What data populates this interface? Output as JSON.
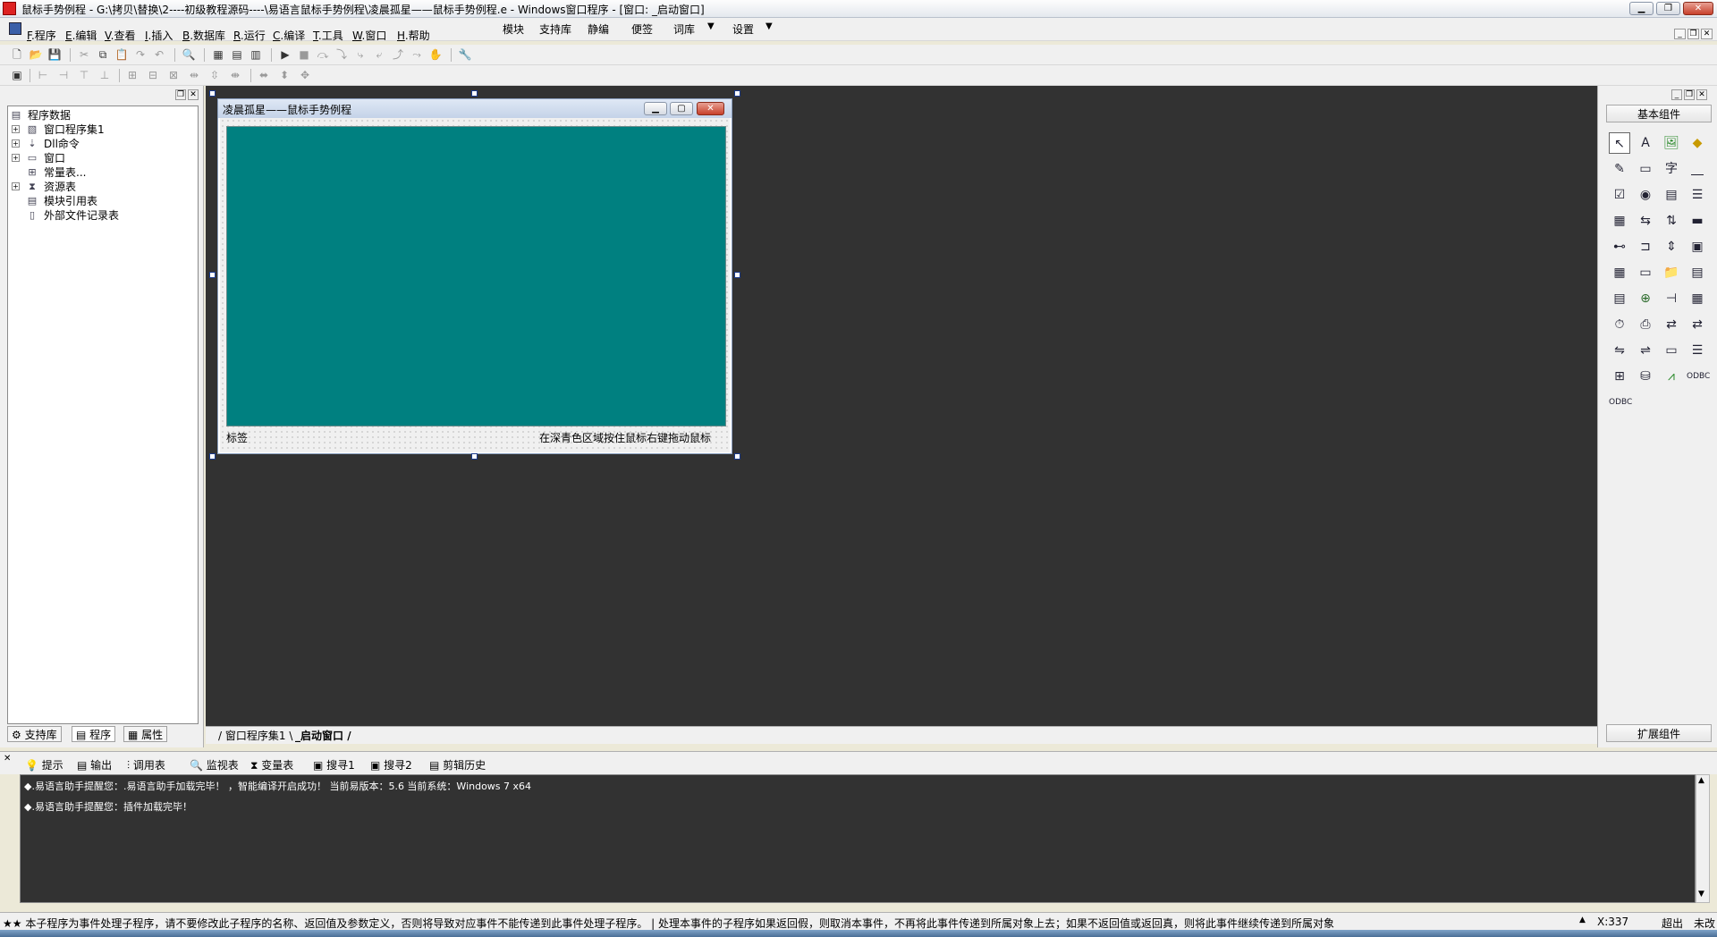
{
  "window": {
    "title": "鼠标手势例程 - G:\\拷贝\\替换\\2----初级教程源码----\\易语言鼠标手势例程\\凌晨孤星——鼠标手势例程.e - Windows窗口程序 - [窗口: _启动窗口]"
  },
  "menu": {
    "items": [
      {
        "key": "F",
        "label": ".程序"
      },
      {
        "key": "E",
        "label": ".编辑"
      },
      {
        "key": "V",
        "label": ".查看"
      },
      {
        "key": "I",
        "label": ".插入"
      },
      {
        "key": "B",
        "label": ".数据库"
      },
      {
        "key": "R",
        "label": ".运行"
      },
      {
        "key": "C",
        "label": ".编译"
      },
      {
        "key": "T",
        "label": ".工具"
      },
      {
        "key": "W",
        "label": ".窗口"
      },
      {
        "key": "H",
        "label": ".帮助"
      }
    ],
    "extra": [
      "模块",
      "支持库",
      "静编",
      "便签",
      "词库",
      "设置"
    ]
  },
  "tree": {
    "items": [
      {
        "label": "程序数据"
      },
      {
        "label": "窗口程序集1"
      },
      {
        "label": "Dll命令"
      },
      {
        "label": "窗口"
      },
      {
        "label": "常量表..."
      },
      {
        "label": "资源表"
      },
      {
        "label": "模块引用表"
      },
      {
        "label": "外部文件记录表"
      }
    ]
  },
  "left_tabs": [
    "支持库",
    "程序",
    "属性"
  ],
  "form": {
    "title": "凌晨孤星——鼠标手势例程",
    "label_left": "标签",
    "label_right": "在深青色区域按住鼠标右键拖动鼠标",
    "teal_color": "#008080"
  },
  "code_tabs": [
    "窗口程序集1",
    "_启动窗口"
  ],
  "right_panel": {
    "header": "基本组件",
    "footer": "扩展组件"
  },
  "output_tabs": [
    "提示",
    "输出",
    "调用表",
    "监视表",
    "变量表",
    "搜寻1",
    "搜寻2",
    "剪辑历史"
  ],
  "output_lines": [
    "◆.易语言助手提醒您：.易语言助手加载完毕！ ，智能编译开启成功！ 当前易版本：5.6  当前系统：Windows 7 x64",
    "◆.易语言助手提醒您：插件加载完毕！"
  ],
  "status": {
    "left": "★★ 本子程序为事件处理子程序，请不要修改此子程序的名称、返回值及参数定义，否则将导致对应事件不能传递到此事件处理子程序。 | 处理本事件的子程序如果返回假，则取消本事件，不再将此事件传递到所属对象上去；如果不返回值或返回真，则将此事件继续传递到所属对象",
    "coord": "X:337",
    "mode": "超出",
    "save": "未改"
  }
}
